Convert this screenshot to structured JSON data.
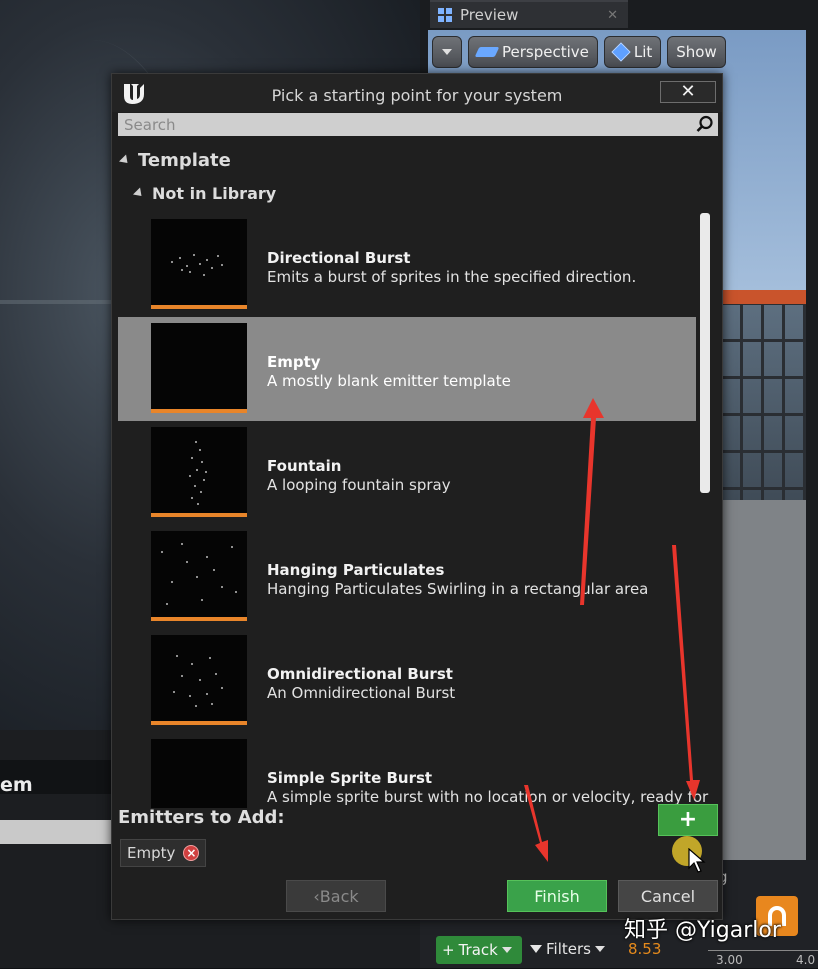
{
  "background": {
    "partial_label": "em",
    "preview_tab": "Preview",
    "toolbar": {
      "perspective": "Perspective",
      "lit": "Lit",
      "show": "Show"
    },
    "dock_tab_fragment": "g",
    "track_button": "Track",
    "filters_button": "Filters",
    "time_value": "8.53",
    "ruler_ticks": [
      "3.00",
      "4.0"
    ],
    "watermark": "知乎 @Yigarlor"
  },
  "dialog": {
    "title": "Pick a starting point for your system",
    "close_label": "✕",
    "search": {
      "placeholder": "Search",
      "value": ""
    },
    "category": "Template",
    "subcategory": "Not in Library",
    "items": [
      {
        "name": "Directional Burst",
        "description": "Emits a burst of sprites in the specified direction.",
        "selected": false
      },
      {
        "name": "Empty",
        "description": "A mostly blank emitter template",
        "selected": true
      },
      {
        "name": "Fountain",
        "description": "A looping fountain spray",
        "selected": false
      },
      {
        "name": "Hanging Particulates",
        "description": "Hanging Particulates Swirling in a rectangular area",
        "selected": false
      },
      {
        "name": "Omnidirectional Burst",
        "description": "An Omnidirectional Burst",
        "selected": false
      },
      {
        "name": "Simple Sprite Burst",
        "description": "A simple sprite burst with no location or velocity, ready for",
        "selected": false
      }
    ],
    "emitters_to_add_label": "Emitters to Add:",
    "add_button_label": "+",
    "emitters_to_add": [
      "Empty"
    ],
    "buttons": {
      "back": "Back",
      "finish": "Finish",
      "cancel": "Cancel"
    },
    "colors": {
      "finish_green": "#3aa24a",
      "selection_gray": "#8a8a8a",
      "thumb_bar_orange": "#e8852a",
      "annotation_red": "#e8352c"
    }
  }
}
